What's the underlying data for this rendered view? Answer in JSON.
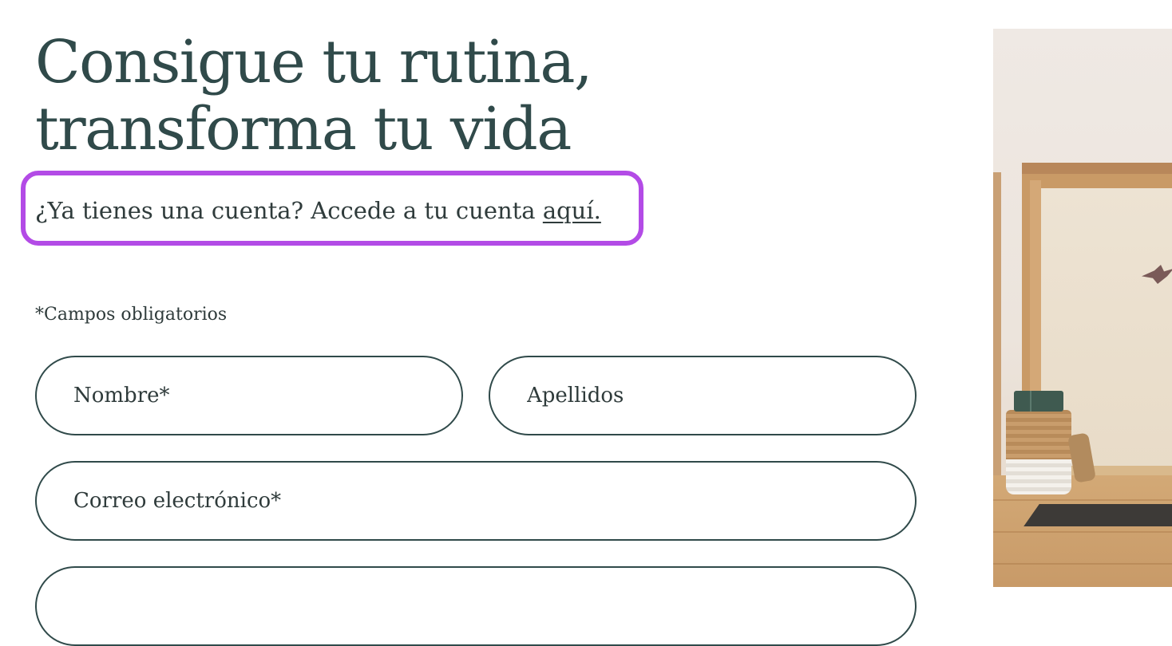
{
  "heading": {
    "line1": "Consigue tu rutina,",
    "line2": "transforma tu vida"
  },
  "login_prompt": {
    "text": "¿Ya tienes una cuenta? Accede a tu cuenta ",
    "link_label": "aquí."
  },
  "form": {
    "required_note": "*Campos obligatorios",
    "fields": {
      "first_name": {
        "placeholder": "Nombre*",
        "value": ""
      },
      "last_name": {
        "placeholder": "Apellidos",
        "value": ""
      },
      "email": {
        "placeholder": "Correo electrónico*",
        "value": ""
      },
      "next": {
        "placeholder": "",
        "value": ""
      }
    }
  },
  "colors": {
    "text": "#304a4a",
    "highlight": "#b34be6",
    "field_border": "#304a4a"
  }
}
